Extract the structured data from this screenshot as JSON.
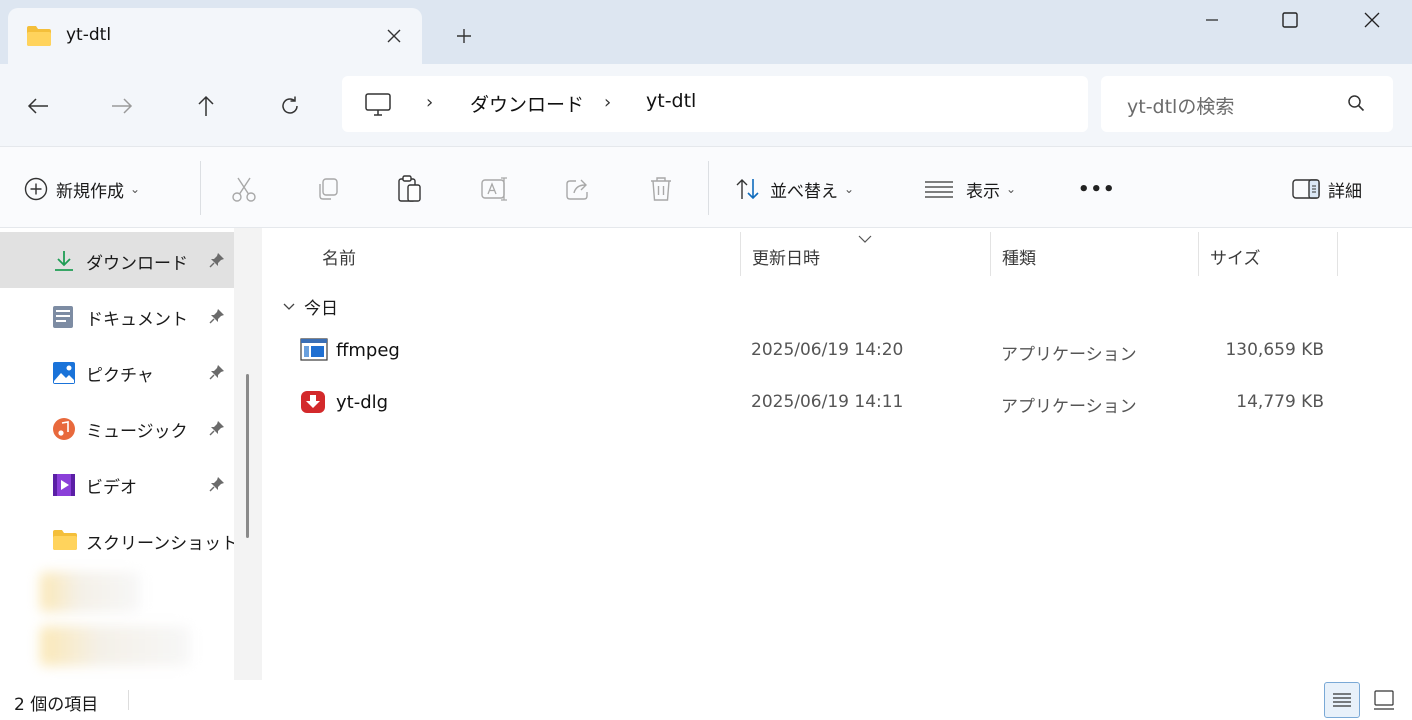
{
  "window": {
    "tab_title": "yt-dtl",
    "tab_close": "✕",
    "new_tab": "+",
    "minimize": "—",
    "maximize": "☐",
    "close": "✕"
  },
  "nav": {
    "breadcrumbs": [
      "ダウンロード",
      "yt-dtl"
    ],
    "separator": "›",
    "search_placeholder": "yt-dtlの検索"
  },
  "toolbar": {
    "new_label": "新規作成",
    "sort_label": "並べ替え",
    "view_label": "表示",
    "more_label": "•••",
    "details_label": "詳細"
  },
  "sidebar": {
    "items": [
      {
        "label": "ダウンロード",
        "icon": "download-icon",
        "pinned": true,
        "selected": true
      },
      {
        "label": "ドキュメント",
        "icon": "document-icon",
        "pinned": true
      },
      {
        "label": "ピクチャ",
        "icon": "pictures-icon",
        "pinned": true
      },
      {
        "label": "ミュージック",
        "icon": "music-icon",
        "pinned": true
      },
      {
        "label": "ビデオ",
        "icon": "video-icon",
        "pinned": true
      },
      {
        "label": "スクリーンショット",
        "icon": "folder-icon",
        "pinned": false
      }
    ]
  },
  "content": {
    "columns": {
      "name": "名前",
      "date": "更新日時",
      "type": "種類",
      "size": "サイズ"
    },
    "group": "今日",
    "files": [
      {
        "name": "ffmpeg",
        "date": "2025/06/19 14:20",
        "type": "アプリケーション",
        "size": "130,659 KB",
        "icon": "ffmpeg-app-icon"
      },
      {
        "name": "yt-dlg",
        "date": "2025/06/19 14:11",
        "type": "アプリケーション",
        "size": "14,779 KB",
        "icon": "yt-dlg-app-icon"
      }
    ]
  },
  "status": {
    "item_count": "2 個の項目"
  },
  "colors": {
    "titlebar": "#dde6f1",
    "navrow": "#f3f6fa",
    "accent": "#0f6cbd",
    "selected": "#e1e1e1"
  }
}
